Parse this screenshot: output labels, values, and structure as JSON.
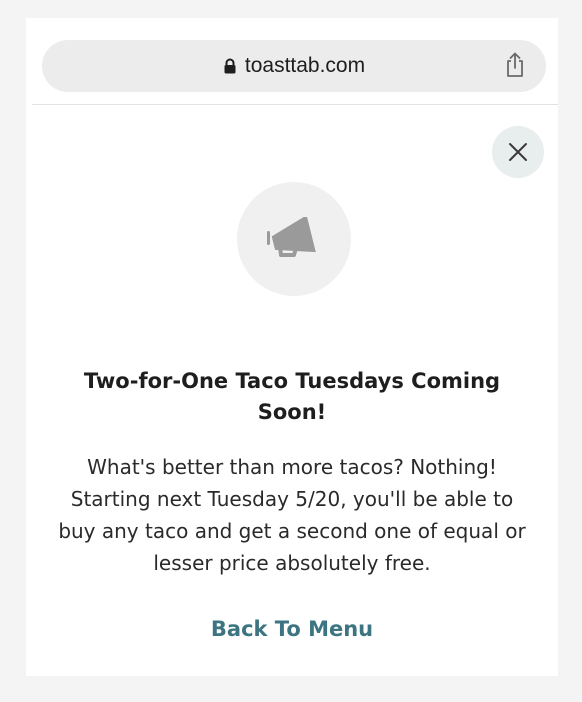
{
  "browser": {
    "url": "toasttab.com",
    "lock_icon": "lock-icon",
    "share_icon": "share-icon"
  },
  "modal": {
    "close_icon": "close-icon",
    "hero_icon": "megaphone-icon",
    "title": "Two-for-One Taco Tuesdays Coming Soon!",
    "body": "What's better than more tacos? Nothing! Starting next Tuesday 5/20, you'll be able to buy any taco and get a second one of equal or lesser price absolutely free.",
    "back_label": "Back To Menu"
  },
  "colors": {
    "accent": "#3c7581",
    "close_bg": "#e8eded",
    "hero_bg": "#f0f0f0",
    "icon": "#9a9a9a"
  }
}
